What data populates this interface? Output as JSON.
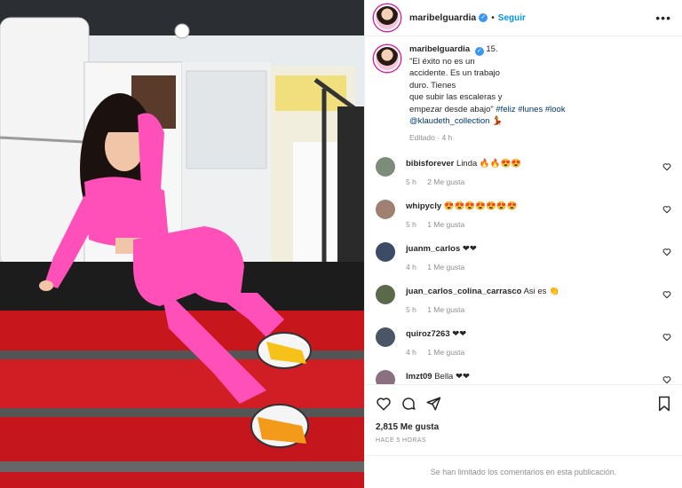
{
  "header": {
    "username": "maribelguardia",
    "separator": "•",
    "follow_label": "Seguir",
    "more_label": "•••"
  },
  "caption": {
    "username": "maribelguardia",
    "line1": "15.",
    "line2": "\"El éxito no es un",
    "line3": "accidente. Es un trabajo",
    "line4": "duro. Tienes",
    "line5": "que subir las escaleras y",
    "line6": "empezar desde abajo\"",
    "tag_feliz": "#feliz",
    "tag_lunes": "#lunes",
    "tag_look": "#look",
    "mention": "@klaudeth_collection",
    "emoji": "💃",
    "edited": "Editado",
    "time": "4 h"
  },
  "comments": [
    {
      "user": "bibisforever",
      "text": "Linda 🔥🔥😍😍",
      "time": "5 h",
      "likes": "2 Me gusta",
      "color": "#7c8b7a"
    },
    {
      "user": "whipycly",
      "text": "😍😍😍😍😍😍😍",
      "time": "5 h",
      "likes": "1 Me gusta",
      "color": "#a08070"
    },
    {
      "user": "juanm_carlos",
      "text": "❤❤",
      "time": "4 h",
      "likes": "1 Me gusta",
      "color": "#3c4b66"
    },
    {
      "user": "juan_carlos_colina_carrasco",
      "text": "Asi es 👏",
      "time": "5 h",
      "likes": "1 Me gusta",
      "color": "#5a6a4a"
    },
    {
      "user": "quiroz7263",
      "text": "❤❤",
      "time": "4 h",
      "likes": "1 Me gusta",
      "color": "#4a5566"
    },
    {
      "user": "lmzt09",
      "text": "Bella ❤❤",
      "time": "",
      "likes": "",
      "color": "#8a7080"
    }
  ],
  "actions": {
    "likes": "2,815 Me gusta",
    "ago": "HACE 5 HORAS"
  },
  "footer": {
    "limited": "Se han limitado los comentarios en esta publicación."
  },
  "colors": {
    "accent": "#0095f6",
    "pink_outfit": "#ff4fb8",
    "stairs_red": "#c8161d"
  }
}
